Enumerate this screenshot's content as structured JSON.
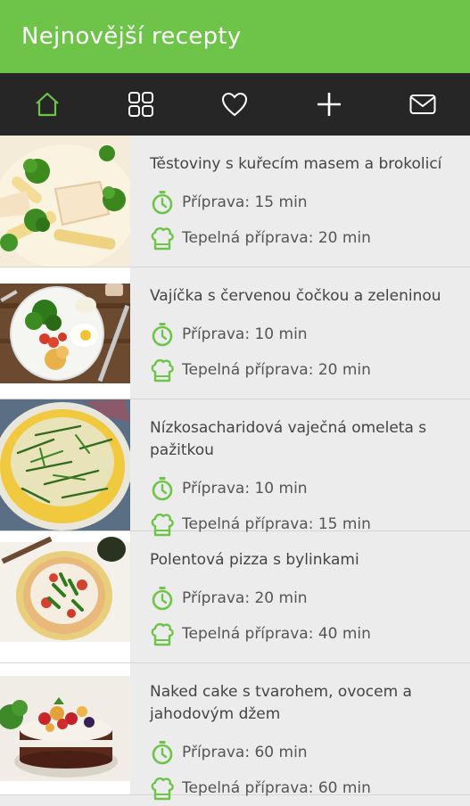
{
  "header": {
    "title": "Nejnovější recepty"
  },
  "tabs": [
    {
      "icon": "home-icon",
      "active": true
    },
    {
      "icon": "grid-icon",
      "active": false
    },
    {
      "icon": "heart-icon",
      "active": false
    },
    {
      "icon": "plus-icon",
      "active": false
    },
    {
      "icon": "mail-icon",
      "active": false
    }
  ],
  "colors": {
    "accent": "#6dc449",
    "tabbar": "#262626",
    "background": "#ececec"
  },
  "recipes": [
    {
      "title": "Těstoviny s kuřecím masem a brokolicí",
      "prep": "Příprava: 15 min",
      "cook": "Tepelná příprava: 20 min"
    },
    {
      "title": "Vajíčka s červenou čočkou a zeleninou",
      "prep": "Příprava: 10 min",
      "cook": "Tepelná příprava: 20 min"
    },
    {
      "title": "Nízkosacharidová vaječná omeleta s pažitkou",
      "prep": "Příprava: 10 min",
      "cook": "Tepelná příprava: 15 min"
    },
    {
      "title": "Polentová pizza s bylinkami",
      "prep": "Příprava: 20 min",
      "cook": "Tepelná příprava: 40 min"
    },
    {
      "title": "Naked cake s tvarohem, ovocem a jahodovým džem",
      "prep": "Příprava: 60 min",
      "cook": "Tepelná příprava: 60 min"
    }
  ]
}
